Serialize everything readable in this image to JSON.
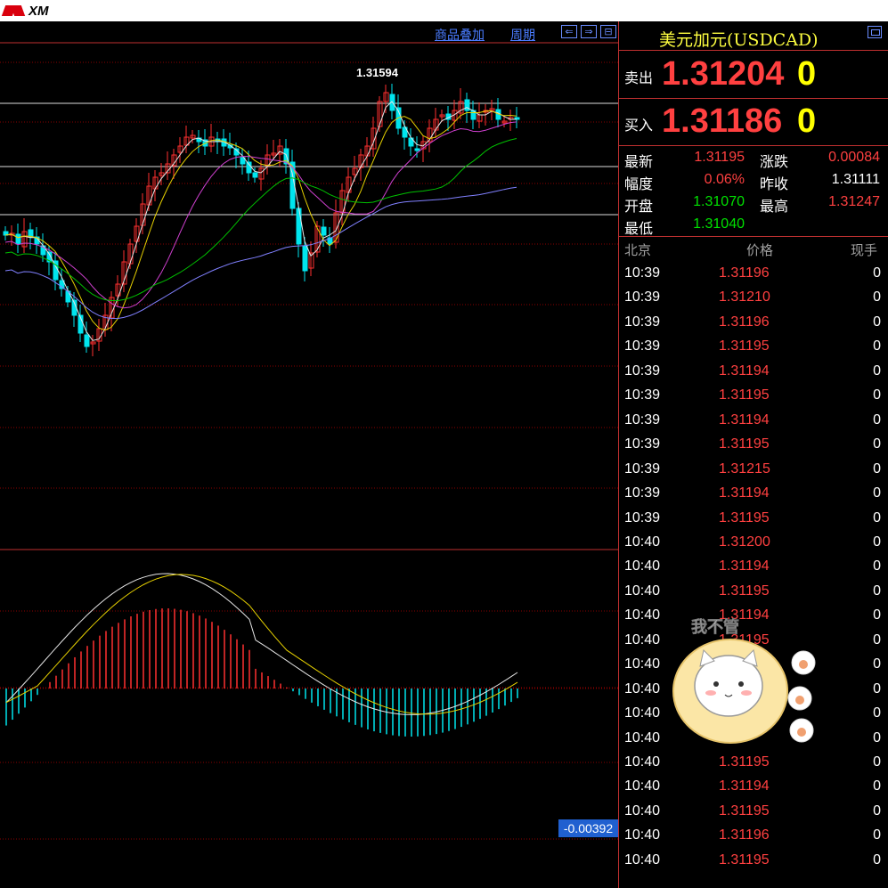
{
  "logo": {
    "text": "XM"
  },
  "toolbar": {
    "overlay_label": "商品叠加",
    "period_label": "周期",
    "nav_left": "⇐",
    "nav_right": "⇒",
    "nav_split": "⊟"
  },
  "chart": {
    "high_marker": "1.31594",
    "macd_value": "-0.00392",
    "colors": {
      "bull": "#ff3030",
      "bear": "#00e5ee",
      "ma_white": "#e6e6e6",
      "ma_yellow": "#e6d000",
      "ma_magenta": "#d040d0",
      "ma_green": "#00c000",
      "ma_purple": "#8080ff",
      "grid": "#8a0000"
    }
  },
  "symbol": {
    "title": "美元加元(USDCAD)"
  },
  "quote": {
    "sell_label": "卖出",
    "sell_price": "1.31204",
    "sell_volume": "0",
    "buy_label": "买入",
    "buy_price": "1.31186",
    "buy_volume": "0"
  },
  "stats": {
    "latest_label": "最新",
    "latest": "1.31195",
    "change_label": "涨跌",
    "change": "0.00084",
    "range_label": "幅度",
    "range": "0.06%",
    "prev_close_label": "昨收",
    "prev_close": "1.31111",
    "open_label": "开盘",
    "open": "1.31070",
    "high_label": "最高",
    "high": "1.31247",
    "low_label": "最低",
    "low": "1.31040"
  },
  "ticks": {
    "headers": {
      "time": "北京",
      "price": "价格",
      "volume": "现手"
    },
    "rows": [
      {
        "time": "10:39",
        "price": "1.31196",
        "volume": "0"
      },
      {
        "time": "10:39",
        "price": "1.31210",
        "volume": "0"
      },
      {
        "time": "10:39",
        "price": "1.31196",
        "volume": "0"
      },
      {
        "time": "10:39",
        "price": "1.31195",
        "volume": "0"
      },
      {
        "time": "10:39",
        "price": "1.31194",
        "volume": "0"
      },
      {
        "time": "10:39",
        "price": "1.31195",
        "volume": "0"
      },
      {
        "time": "10:39",
        "price": "1.31194",
        "volume": "0"
      },
      {
        "time": "10:39",
        "price": "1.31195",
        "volume": "0"
      },
      {
        "time": "10:39",
        "price": "1.31215",
        "volume": "0"
      },
      {
        "time": "10:39",
        "price": "1.31194",
        "volume": "0"
      },
      {
        "time": "10:39",
        "price": "1.31195",
        "volume": "0"
      },
      {
        "time": "10:40",
        "price": "1.31200",
        "volume": "0"
      },
      {
        "time": "10:40",
        "price": "1.31194",
        "volume": "0"
      },
      {
        "time": "10:40",
        "price": "1.31195",
        "volume": "0"
      },
      {
        "time": "10:40",
        "price": "1.31194",
        "volume": "0"
      },
      {
        "time": "10:40",
        "price": "1.31195",
        "volume": "0"
      },
      {
        "time": "10:40",
        "price": "",
        "volume": "0"
      },
      {
        "time": "10:40",
        "price": "",
        "volume": "0"
      },
      {
        "time": "10:40",
        "price": "",
        "volume": "0"
      },
      {
        "time": "10:40",
        "price": "",
        "volume": "0"
      },
      {
        "time": "10:40",
        "price": "1.31195",
        "volume": "0"
      },
      {
        "time": "10:40",
        "price": "1.31194",
        "volume": "0"
      },
      {
        "time": "10:40",
        "price": "1.31195",
        "volume": "0"
      },
      {
        "time": "10:40",
        "price": "1.31196",
        "volume": "0"
      },
      {
        "time": "10:40",
        "price": "1.31195",
        "volume": "0"
      }
    ]
  },
  "sticker": {
    "text": "我不管"
  }
}
